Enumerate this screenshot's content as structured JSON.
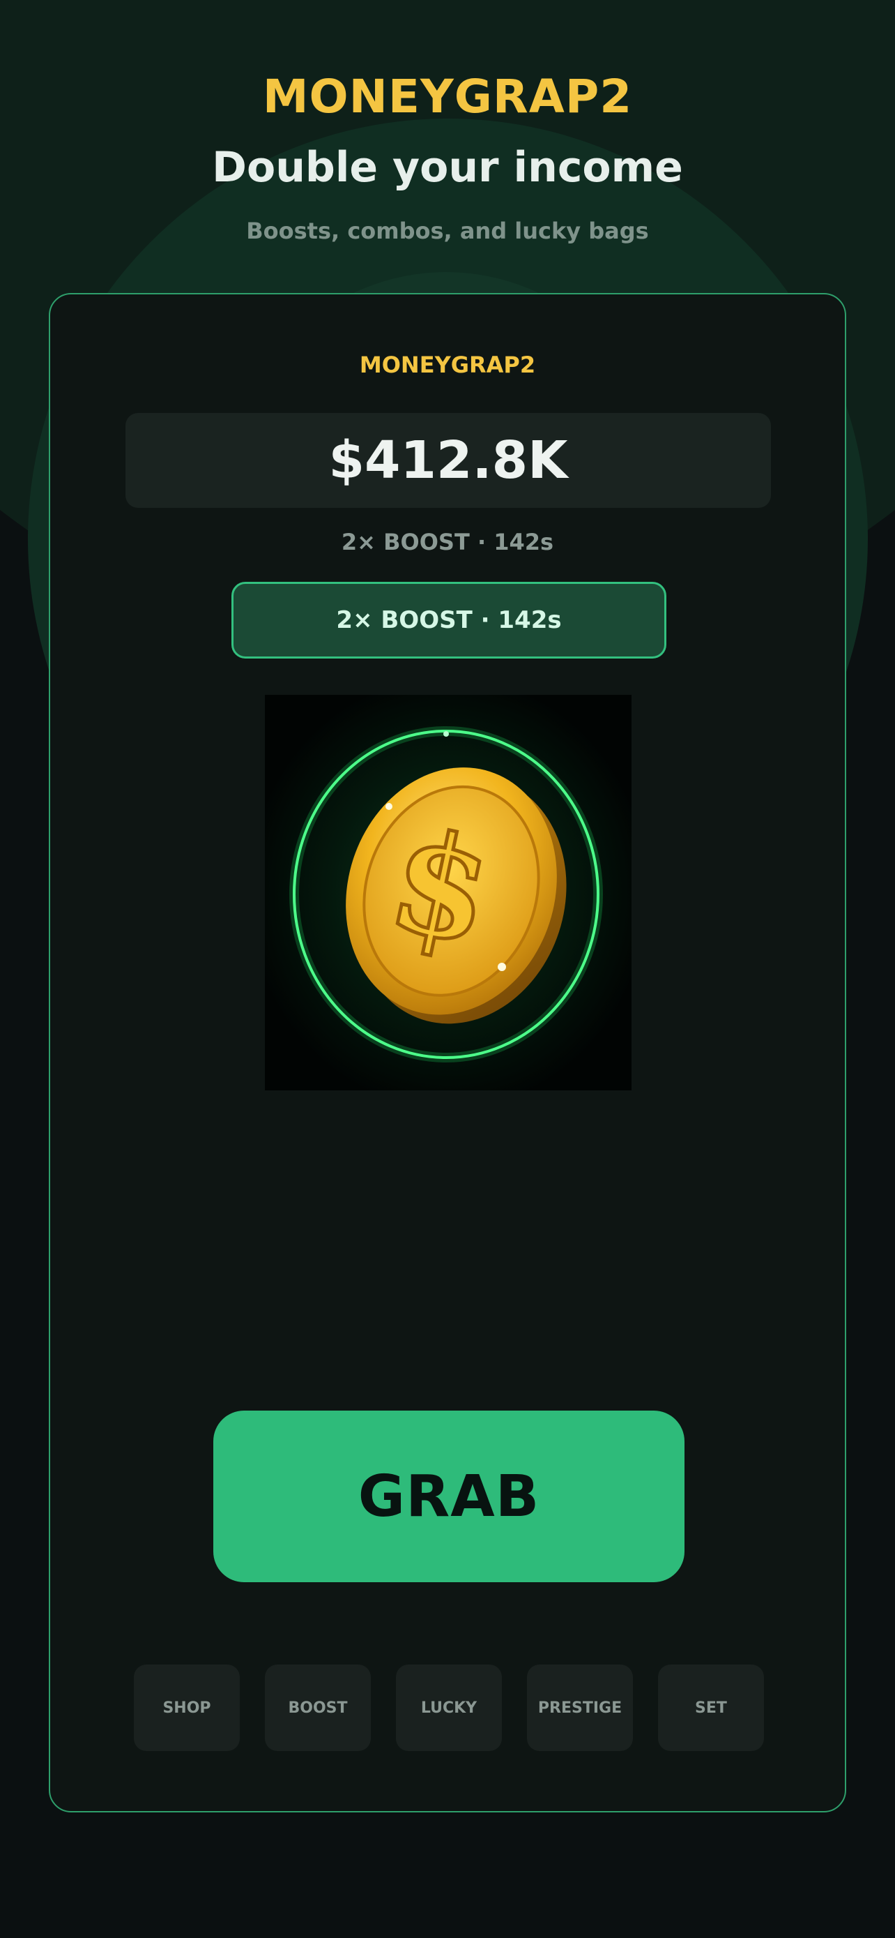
{
  "header": {
    "app_title": "MONEYGRAP2",
    "headline": "Double your income",
    "subline": "Boosts, combos, and lucky bags"
  },
  "card": {
    "title": "MONEYGRAP2",
    "balance": "$412.8K",
    "boost_status": "2× BOOST · 142s",
    "boost_button": "2× BOOST · 142s",
    "coin_image": "gold-dollar-coin-icon",
    "grab_label": "GRAB"
  },
  "nav": {
    "items": [
      {
        "label": "SHOP"
      },
      {
        "label": "BOOST"
      },
      {
        "label": "LUCKY"
      },
      {
        "label": "PRESTIGE"
      },
      {
        "label": "SET"
      }
    ]
  },
  "colors": {
    "accent_gold": "#f4c542",
    "accent_green": "#2ebb7a",
    "background": "#0a0f10",
    "card_border": "#2e9f6b"
  }
}
